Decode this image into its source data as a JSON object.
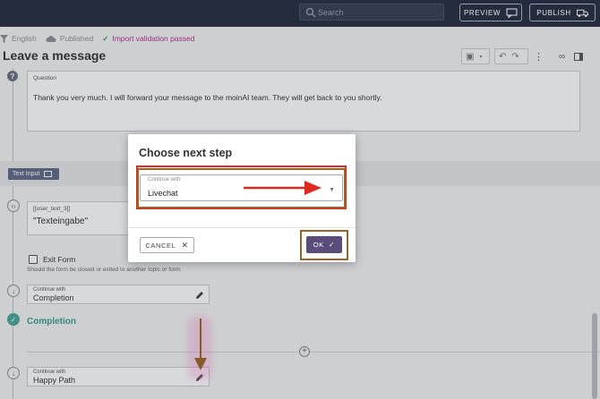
{
  "topbar": {
    "search_placeholder": "Search",
    "preview_label": "PREVIEW",
    "publish_label": "PUBLISH"
  },
  "status": {
    "language": "English",
    "published": "Published",
    "validation": "Import validation passed"
  },
  "page": {
    "title": "Leave a message"
  },
  "question": {
    "label": "Question",
    "text": "Thank you very much. I will forward your message to the moinAI team. They will get back to you shortly."
  },
  "text_input_tag": "Text Input",
  "user_text": {
    "label": "[[user_text_3]]",
    "value": "\"Texteingabe\""
  },
  "exit_form": {
    "label": "Exit Form",
    "help": "Should the form be closed or exited to another topic or form."
  },
  "continue_with_1": {
    "label": "Continue with",
    "value": "Completion"
  },
  "completion_label": "Completion",
  "continue_with_2": {
    "label": "Continue with",
    "value": "Happy Path"
  },
  "dialog": {
    "title": "Choose next step",
    "field_label": "Continue with",
    "field_value": "Livechat",
    "cancel_label": "CANCEL",
    "ok_label": "OK"
  },
  "colors": {
    "topbar": "#2a3347",
    "accent": "#5a4d7c",
    "completion": "#3a9c8e",
    "highlight_red": "#e02a1f",
    "highlight_brown": "#9a6328"
  }
}
